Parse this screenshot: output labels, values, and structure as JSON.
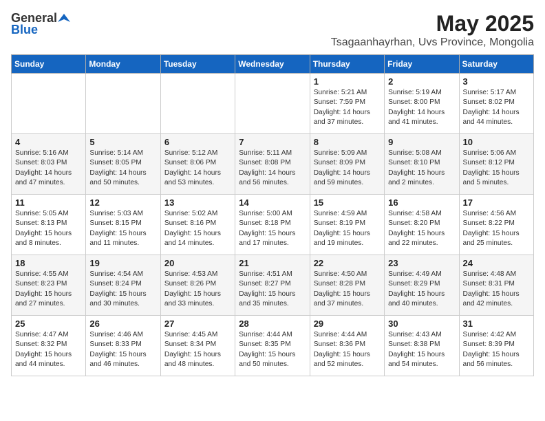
{
  "header": {
    "logo_general": "General",
    "logo_blue": "Blue",
    "month_title": "May 2025",
    "location": "Tsagaanhayrhan, Uvs Province, Mongolia"
  },
  "weekdays": [
    "Sunday",
    "Monday",
    "Tuesday",
    "Wednesday",
    "Thursday",
    "Friday",
    "Saturday"
  ],
  "weeks": [
    [
      {
        "day": "",
        "info": ""
      },
      {
        "day": "",
        "info": ""
      },
      {
        "day": "",
        "info": ""
      },
      {
        "day": "",
        "info": ""
      },
      {
        "day": "1",
        "info": "Sunrise: 5:21 AM\nSunset: 7:59 PM\nDaylight: 14 hours\nand 37 minutes."
      },
      {
        "day": "2",
        "info": "Sunrise: 5:19 AM\nSunset: 8:00 PM\nDaylight: 14 hours\nand 41 minutes."
      },
      {
        "day": "3",
        "info": "Sunrise: 5:17 AM\nSunset: 8:02 PM\nDaylight: 14 hours\nand 44 minutes."
      }
    ],
    [
      {
        "day": "4",
        "info": "Sunrise: 5:16 AM\nSunset: 8:03 PM\nDaylight: 14 hours\nand 47 minutes."
      },
      {
        "day": "5",
        "info": "Sunrise: 5:14 AM\nSunset: 8:05 PM\nDaylight: 14 hours\nand 50 minutes."
      },
      {
        "day": "6",
        "info": "Sunrise: 5:12 AM\nSunset: 8:06 PM\nDaylight: 14 hours\nand 53 minutes."
      },
      {
        "day": "7",
        "info": "Sunrise: 5:11 AM\nSunset: 8:08 PM\nDaylight: 14 hours\nand 56 minutes."
      },
      {
        "day": "8",
        "info": "Sunrise: 5:09 AM\nSunset: 8:09 PM\nDaylight: 14 hours\nand 59 minutes."
      },
      {
        "day": "9",
        "info": "Sunrise: 5:08 AM\nSunset: 8:10 PM\nDaylight: 15 hours\nand 2 minutes."
      },
      {
        "day": "10",
        "info": "Sunrise: 5:06 AM\nSunset: 8:12 PM\nDaylight: 15 hours\nand 5 minutes."
      }
    ],
    [
      {
        "day": "11",
        "info": "Sunrise: 5:05 AM\nSunset: 8:13 PM\nDaylight: 15 hours\nand 8 minutes."
      },
      {
        "day": "12",
        "info": "Sunrise: 5:03 AM\nSunset: 8:15 PM\nDaylight: 15 hours\nand 11 minutes."
      },
      {
        "day": "13",
        "info": "Sunrise: 5:02 AM\nSunset: 8:16 PM\nDaylight: 15 hours\nand 14 minutes."
      },
      {
        "day": "14",
        "info": "Sunrise: 5:00 AM\nSunset: 8:18 PM\nDaylight: 15 hours\nand 17 minutes."
      },
      {
        "day": "15",
        "info": "Sunrise: 4:59 AM\nSunset: 8:19 PM\nDaylight: 15 hours\nand 19 minutes."
      },
      {
        "day": "16",
        "info": "Sunrise: 4:58 AM\nSunset: 8:20 PM\nDaylight: 15 hours\nand 22 minutes."
      },
      {
        "day": "17",
        "info": "Sunrise: 4:56 AM\nSunset: 8:22 PM\nDaylight: 15 hours\nand 25 minutes."
      }
    ],
    [
      {
        "day": "18",
        "info": "Sunrise: 4:55 AM\nSunset: 8:23 PM\nDaylight: 15 hours\nand 27 minutes."
      },
      {
        "day": "19",
        "info": "Sunrise: 4:54 AM\nSunset: 8:24 PM\nDaylight: 15 hours\nand 30 minutes."
      },
      {
        "day": "20",
        "info": "Sunrise: 4:53 AM\nSunset: 8:26 PM\nDaylight: 15 hours\nand 33 minutes."
      },
      {
        "day": "21",
        "info": "Sunrise: 4:51 AM\nSunset: 8:27 PM\nDaylight: 15 hours\nand 35 minutes."
      },
      {
        "day": "22",
        "info": "Sunrise: 4:50 AM\nSunset: 8:28 PM\nDaylight: 15 hours\nand 37 minutes."
      },
      {
        "day": "23",
        "info": "Sunrise: 4:49 AM\nSunset: 8:29 PM\nDaylight: 15 hours\nand 40 minutes."
      },
      {
        "day": "24",
        "info": "Sunrise: 4:48 AM\nSunset: 8:31 PM\nDaylight: 15 hours\nand 42 minutes."
      }
    ],
    [
      {
        "day": "25",
        "info": "Sunrise: 4:47 AM\nSunset: 8:32 PM\nDaylight: 15 hours\nand 44 minutes."
      },
      {
        "day": "26",
        "info": "Sunrise: 4:46 AM\nSunset: 8:33 PM\nDaylight: 15 hours\nand 46 minutes."
      },
      {
        "day": "27",
        "info": "Sunrise: 4:45 AM\nSunset: 8:34 PM\nDaylight: 15 hours\nand 48 minutes."
      },
      {
        "day": "28",
        "info": "Sunrise: 4:44 AM\nSunset: 8:35 PM\nDaylight: 15 hours\nand 50 minutes."
      },
      {
        "day": "29",
        "info": "Sunrise: 4:44 AM\nSunset: 8:36 PM\nDaylight: 15 hours\nand 52 minutes."
      },
      {
        "day": "30",
        "info": "Sunrise: 4:43 AM\nSunset: 8:38 PM\nDaylight: 15 hours\nand 54 minutes."
      },
      {
        "day": "31",
        "info": "Sunrise: 4:42 AM\nSunset: 8:39 PM\nDaylight: 15 hours\nand 56 minutes."
      }
    ]
  ]
}
